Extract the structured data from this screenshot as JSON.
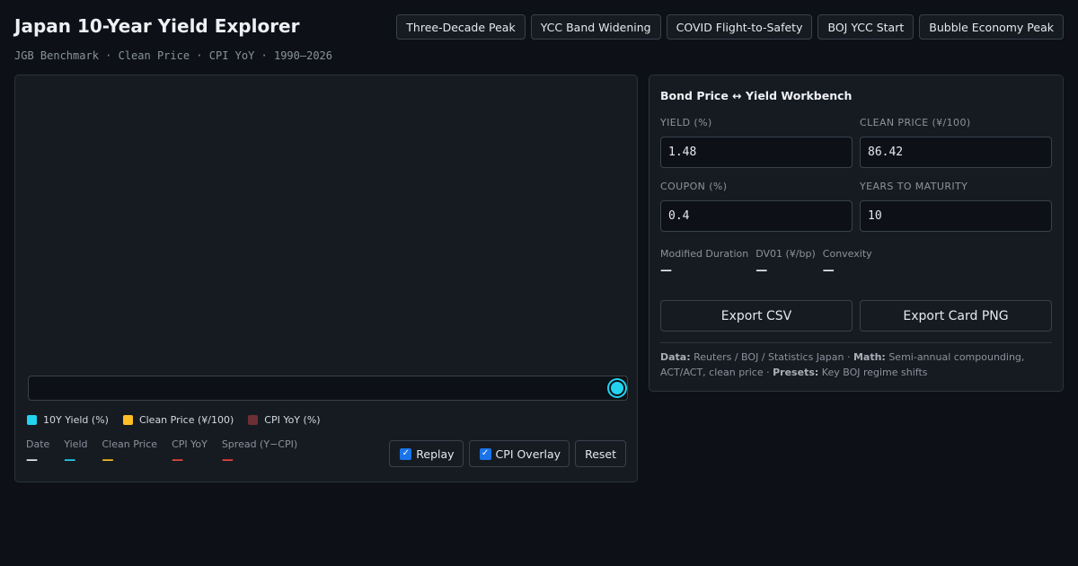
{
  "header": {
    "title": "Japan 10-Year Yield Explorer",
    "subtitle": "JGB Benchmark · Clean Price · CPI YoY · 1990–2026"
  },
  "presets": [
    {
      "label": "Three-Decade Peak"
    },
    {
      "label": "YCC Band Widening"
    },
    {
      "label": "COVID Flight-to-Safety"
    },
    {
      "label": "BOJ YCC Start"
    },
    {
      "label": "Bubble Economy Peak"
    }
  ],
  "chart": {
    "legend": [
      {
        "label": "10Y Yield (%)",
        "color": "#22d3ee"
      },
      {
        "label": "Clean Price (¥/100)",
        "color": "#fbbf24"
      },
      {
        "label": "CPI YoY (%)",
        "color": "#6b2f35"
      }
    ],
    "readout": [
      {
        "label": "Date",
        "value": "—",
        "color": "#e6e8eb"
      },
      {
        "label": "Yield",
        "value": "—",
        "color": "#22d3ee"
      },
      {
        "label": "Clean Price",
        "value": "—",
        "color": "#fbbf24"
      },
      {
        "label": "CPI YoY",
        "value": "—",
        "color": "#ef4444"
      },
      {
        "label": "Spread (Y−CPI)",
        "value": "—",
        "color": "#ef4444"
      }
    ],
    "controls": {
      "replay_label": "Replay",
      "replay_checked": true,
      "cpi_overlay_label": "CPI Overlay",
      "cpi_overlay_checked": true,
      "reset_label": "Reset"
    },
    "scrubber_position": 1.0
  },
  "workbench": {
    "title": "Bond Price ↔ Yield Workbench",
    "fields": {
      "yield": {
        "label": "YIELD (%)",
        "value": "1.48"
      },
      "clean_price": {
        "label": "CLEAN PRICE (¥/100)",
        "value": "86.42"
      },
      "coupon": {
        "label": "COUPON (%)",
        "value": "0.4"
      },
      "years": {
        "label": "YEARS TO MATURITY",
        "value": "10"
      }
    },
    "metrics": [
      {
        "label": "Modified Duration",
        "value": "—"
      },
      {
        "label": "DV01 (¥/bp)",
        "value": "—"
      },
      {
        "label": "Convexity",
        "value": "—"
      }
    ],
    "export_csv_label": "Export CSV",
    "export_png_label": "Export Card PNG",
    "footnote": {
      "data_label": "Data:",
      "data_text": "Reuters / BOJ / Statistics Japan · ",
      "math_label": "Math:",
      "math_text": "Semi-annual compounding, ACT/ACT, clean price · ",
      "presets_label": "Presets:",
      "presets_text": "Key BOJ regime shifts"
    }
  }
}
